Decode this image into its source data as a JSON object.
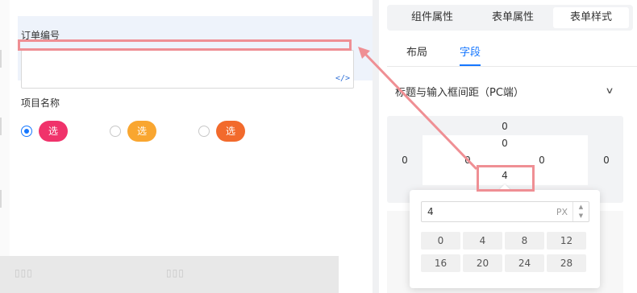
{
  "canvas": {
    "field": {
      "label": "订单编号",
      "value": "",
      "code_icon": "code-icon"
    },
    "radio_group": {
      "label": "项目名称",
      "options": [
        {
          "label": "选项一",
          "color": "#f0336b",
          "checked": true
        },
        {
          "label": "选项二",
          "color": "#f9a630",
          "checked": false
        },
        {
          "label": "选项三",
          "color": "#f26a2c",
          "checked": false
        }
      ]
    }
  },
  "panel": {
    "top_tabs": [
      {
        "label": "组件属性",
        "active": false
      },
      {
        "label": "表单属性",
        "active": false
      },
      {
        "label": "表单样式",
        "active": true
      }
    ],
    "sub_tabs": [
      {
        "label": "布局",
        "active": false
      },
      {
        "label": "字段",
        "active": true
      }
    ],
    "section_title": "标题与输入框间距（PC端）",
    "spacing": {
      "outer_top": "0",
      "outer_left": "0",
      "outer_right": "0",
      "inner_top": "0",
      "inner_left": "0",
      "inner_right": "0",
      "inner_bottom": "4"
    },
    "popover": {
      "value": "4",
      "unit": "PX",
      "presets": [
        "0",
        "4",
        "8",
        "12",
        "16",
        "20",
        "24",
        "28"
      ]
    }
  },
  "colors": {
    "accent": "#1677ff",
    "annotation": "#ef8f94"
  }
}
